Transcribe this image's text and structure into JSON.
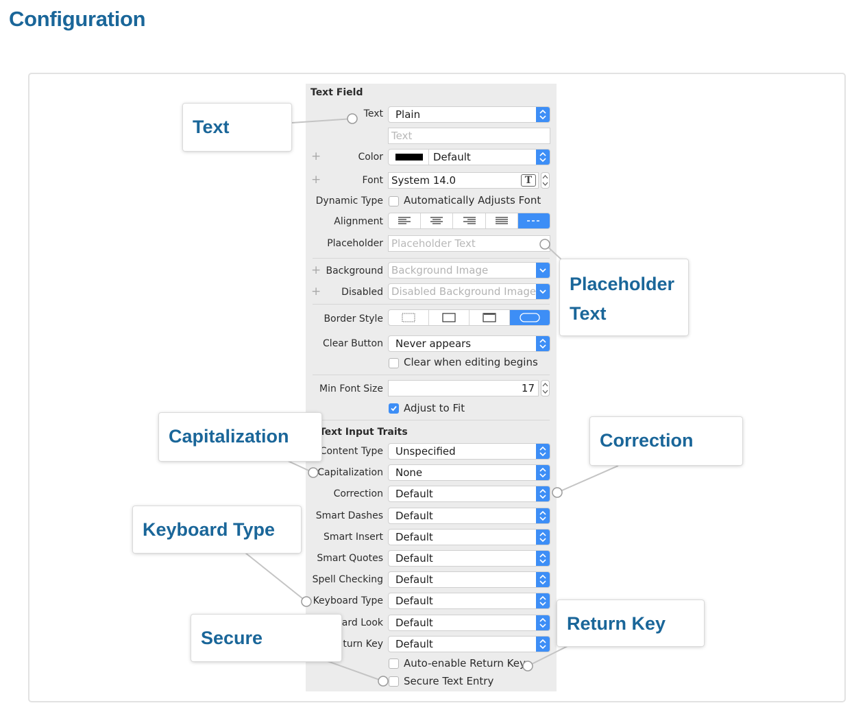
{
  "page": {
    "heading": "Configuration"
  },
  "inspector": {
    "section_text_field": "Text Field",
    "text": {
      "label": "Text",
      "value": "Plain",
      "field_placeholder": "Text"
    },
    "color": {
      "label": "Color",
      "value": "Default",
      "swatch": "#000000"
    },
    "font": {
      "label": "Font",
      "value": "System 14.0",
      "icon_glyph": "T"
    },
    "dynamic_type": {
      "label": "Dynamic Type",
      "checkbox_label": "Automatically Adjusts Font",
      "checked": false
    },
    "alignment": {
      "label": "Alignment",
      "options": [
        "left-align-icon",
        "center-align-icon",
        "right-align-icon",
        "justify-align-icon",
        "natural-align-icon"
      ],
      "selected": "natural-align-icon"
    },
    "placeholder": {
      "label": "Placeholder",
      "value": "Placeholder Text"
    },
    "background": {
      "label": "Background",
      "value": "Background Image"
    },
    "disabled": {
      "label": "Disabled",
      "value": "Disabled Background Image"
    },
    "border_style": {
      "label": "Border Style",
      "options": [
        "border-none-icon",
        "border-line-icon",
        "border-bezel-icon",
        "border-rounded-icon"
      ],
      "selected": "border-rounded-icon"
    },
    "clear_button": {
      "label": "Clear Button",
      "value": "Never appears",
      "checkbox_label": "Clear when editing begins",
      "checked": false
    },
    "min_font_size": {
      "label": "Min Font Size",
      "value": "17"
    },
    "adjust_to_fit": {
      "checkbox_label": "Adjust to Fit",
      "checked": true
    },
    "section_traits": "Text Input Traits",
    "traits": [
      {
        "label": "Content Type",
        "value": "Unspecified"
      },
      {
        "label": "Capitalization",
        "value": "None"
      },
      {
        "label": "Correction",
        "value": "Default"
      },
      {
        "label": "Smart Dashes",
        "value": "Default"
      },
      {
        "label": "Smart Insert",
        "value": "Default"
      },
      {
        "label": "Smart Quotes",
        "value": "Default"
      },
      {
        "label": "Spell Checking",
        "value": "Default"
      },
      {
        "label": "Keyboard Type",
        "value": "Default"
      },
      {
        "label": "ard Look",
        "value": "Default"
      },
      {
        "label": "turn Key",
        "value": "Default"
      }
    ],
    "auto_enable": {
      "checkbox_label": "Auto-enable Return Key",
      "checked": false
    },
    "secure": {
      "checkbox_label": "Secure Text Entry",
      "checked": false
    }
  },
  "callouts": {
    "text": "Text",
    "placeholder_line1": "Placeholder",
    "placeholder_line2": "Text",
    "capitalization": "Capitalization",
    "correction": "Correction",
    "keyboard_type": "Keyboard Type",
    "secure": "Secure",
    "return_key": "Return Key"
  },
  "colors": {
    "heading": "#1a6699",
    "accent": "#3d8ef6",
    "panel": "#ececec"
  }
}
